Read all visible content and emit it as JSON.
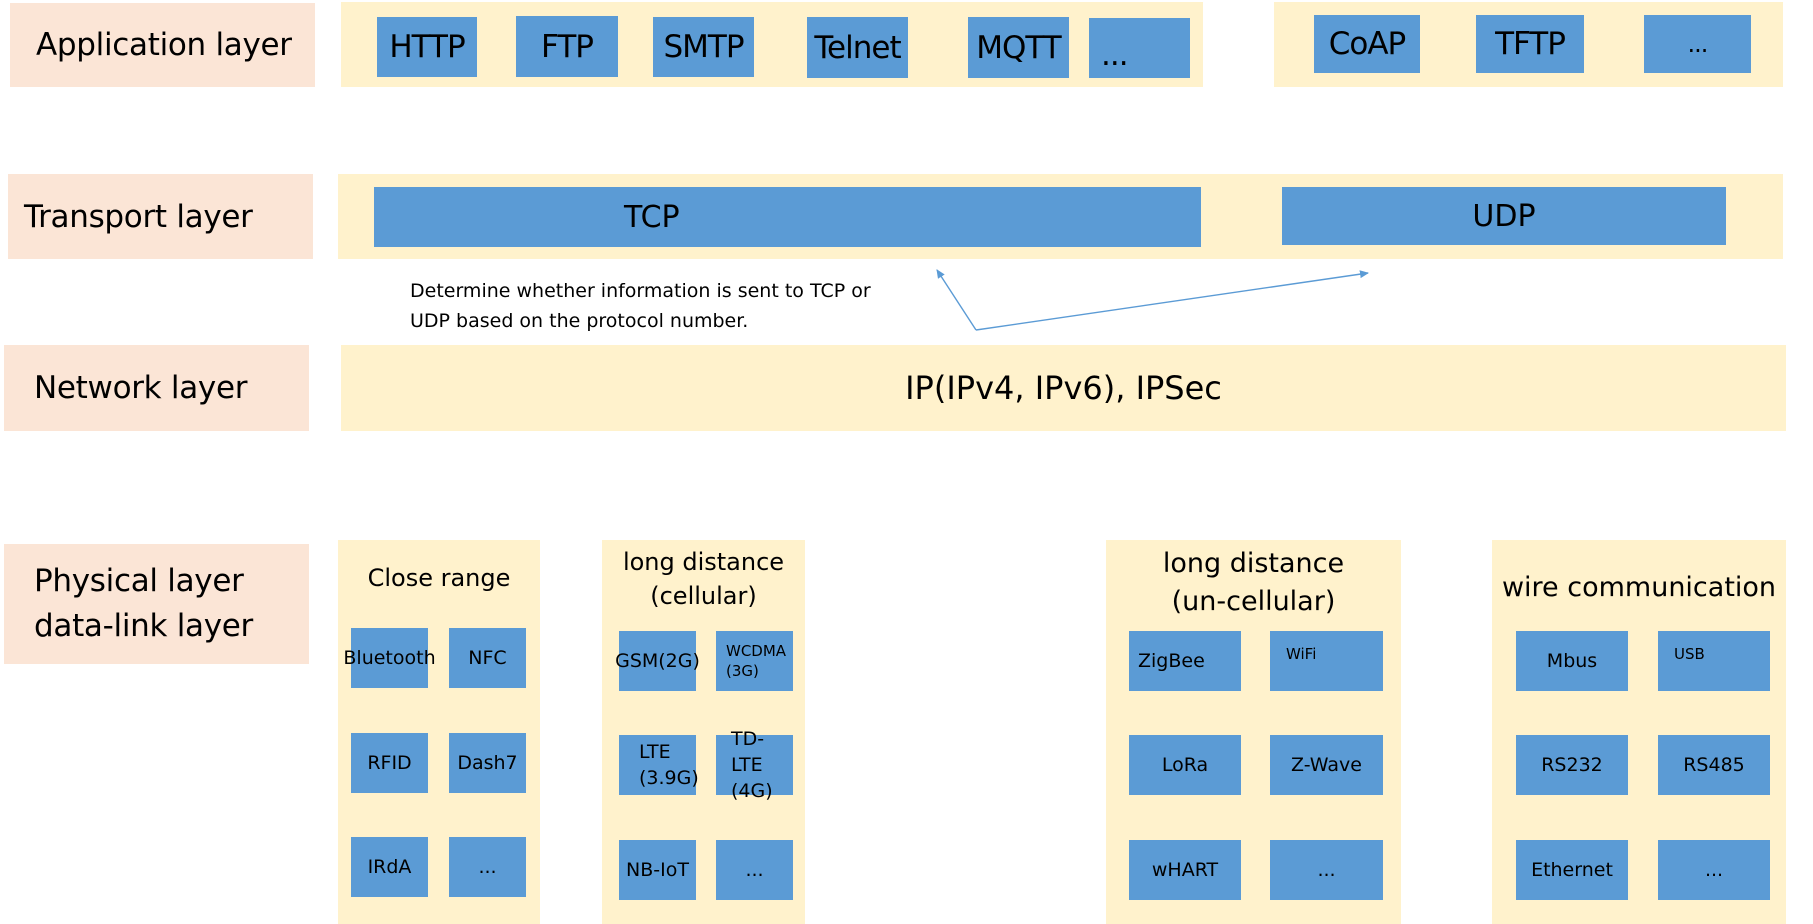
{
  "colors": {
    "layer_label_bg": "#fbe5d6",
    "container_bg": "#fff2cc",
    "protocol_box": "#5b9bd5",
    "arrow": "#5b9bd5"
  },
  "layers": {
    "application": {
      "label": "Application layer",
      "group_a": [
        "HTTP",
        "FTP",
        "SMTP",
        "Telnet",
        "MQTT",
        "..."
      ],
      "group_b": [
        "CoAP",
        "TFTP",
        "..."
      ]
    },
    "transport": {
      "label": "Transport layer",
      "protocols": [
        "TCP",
        "UDP"
      ],
      "note_line1": "Determine whether information is sent to TCP or",
      "note_line2": "UDP based on the protocol number."
    },
    "network": {
      "label": "Network layer",
      "content": "IP(IPv4, IPv6), IPSec"
    },
    "physical": {
      "label_line1": "Physical layer",
      "label_line2": "data-link layer",
      "columns": [
        {
          "title_line1": "Close range",
          "title_line2": "",
          "items": [
            "Bluetooth",
            "NFC",
            "RFID",
            "Dash7",
            "IRdA",
            "..."
          ]
        },
        {
          "title_line1": "long distance",
          "title_line2": "(cellular)",
          "items": [
            "GSM(2G)",
            "WCDMA",
            "(3G)",
            "LTE",
            "(3.9G)",
            "TD-LTE",
            "(4G)",
            "NB-IoT",
            "..."
          ]
        },
        {
          "title_line1": "long distance",
          "title_line2": "(un-cellular)",
          "items": [
            "ZigBee",
            "WiFi",
            "LoRa",
            "Z-Wave",
            "wHART",
            "..."
          ]
        },
        {
          "title_line1": "wire communication",
          "title_line2": "",
          "items": [
            "Mbus",
            "USB",
            "RS232",
            "RS485",
            "Ethernet",
            "..."
          ]
        }
      ]
    }
  }
}
